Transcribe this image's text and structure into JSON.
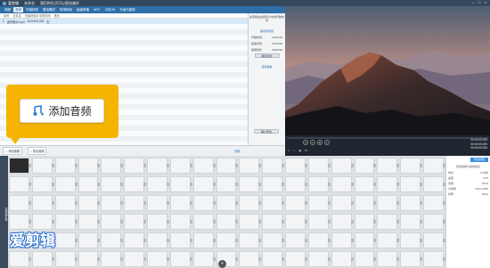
{
  "titlebar": {
    "app_name": "爱剪辑",
    "sub1": "未命名",
    "sub2": "我们的生活可以更加美好"
  },
  "tabs": [
    {
      "label": "视频"
    },
    {
      "label": "音频"
    },
    {
      "label": "字幕特效"
    },
    {
      "label": "叠加素材"
    },
    {
      "label": "转场特效"
    },
    {
      "label": "画面风格"
    },
    {
      "label": "MTV"
    },
    {
      "label": "卡拉OK"
    },
    {
      "label": "升级与服务"
    }
  ],
  "list": {
    "headers": [
      "序号",
      "文件名",
      "在最终影片中的时间",
      "音乐"
    ],
    "row": {
      "num": "1",
      "name": "素材音乐.mp3",
      "time": "00:00:00.000",
      "extra": "无"
    }
  },
  "rightpanel": {
    "title": "此音频在最终影片中的开始时间",
    "section1": "裁剪原音频",
    "row1_label": "开始时间",
    "row1_val": "00:00:00",
    "row2_label": "结束时间",
    "row2_val": "00:00:00",
    "row3_label": "截取时长",
    "row3_val": "00:00:00",
    "btn_label": "确定修改",
    "section2": "音频播放",
    "bottom_label": "确认修改"
  },
  "toolbar": {
    "add_audio": "添加音频",
    "export": "导出音频",
    "extra": "清除"
  },
  "player": {
    "time_current": "00:00:00.000",
    "time_total": "00:00:00.000",
    "time_third": "00:00:00.000"
  },
  "timeline": {
    "side_label": "已添加片段",
    "first_clip_label": "视频素材"
  },
  "props": {
    "button": "导出视频",
    "title": "所选视频片段的信息",
    "rows": [
      {
        "k": "时长",
        "v": "0.00秒"
      },
      {
        "k": "速度",
        "v": "0.00"
      },
      {
        "k": "音量",
        "v": "100%"
      },
      {
        "k": "分辨率",
        "v": "1920x1080"
      },
      {
        "k": "帧率",
        "v": "30fps"
      }
    ]
  },
  "callout": {
    "label": "添加音频"
  },
  "watermark": {
    "text": "爱剪辑"
  },
  "colors": {
    "accent": "#2f6fa8",
    "callout": "#f5b400"
  }
}
